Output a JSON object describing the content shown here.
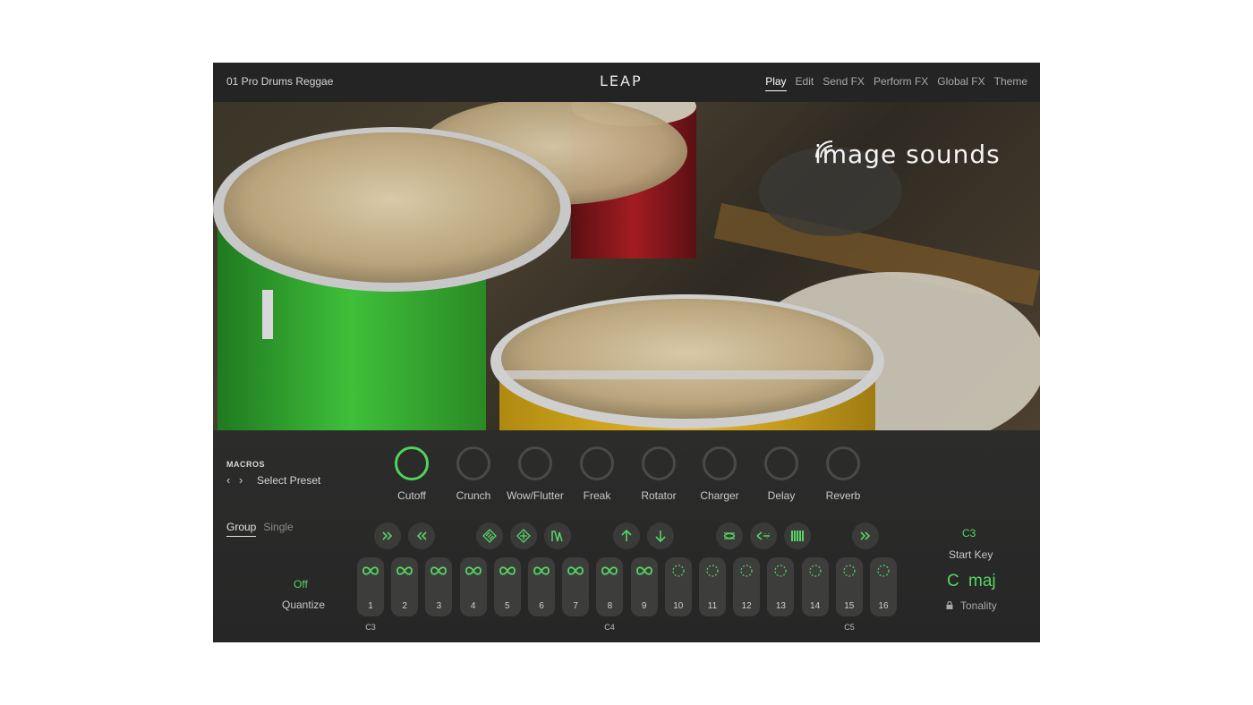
{
  "header": {
    "preset_name": "01 Pro Drums Reggae",
    "logo": "LEAP",
    "tabs": [
      {
        "label": "Play",
        "active": true
      },
      {
        "label": "Edit",
        "active": false
      },
      {
        "label": "Send FX",
        "active": false
      },
      {
        "label": "Perform FX",
        "active": false
      },
      {
        "label": "Global FX",
        "active": false
      },
      {
        "label": "Theme",
        "active": false
      }
    ]
  },
  "hero": {
    "brand": "image sounds",
    "brand_icon": "signal-waves-icon"
  },
  "macros": {
    "title": "MACROS",
    "preset_label": "Select Preset",
    "prev_icon": "chevron-left-icon",
    "next_icon": "chevron-right-icon",
    "knobs": [
      {
        "label": "Cutoff",
        "active": true
      },
      {
        "label": "Crunch",
        "active": false
      },
      {
        "label": "Wow/Flutter",
        "active": false
      },
      {
        "label": "Freak",
        "active": false
      },
      {
        "label": "Rotator",
        "active": false
      },
      {
        "label": "Charger",
        "active": false
      },
      {
        "label": "Delay",
        "active": false
      },
      {
        "label": "Reverb",
        "active": false
      }
    ]
  },
  "modes": {
    "tabs": [
      {
        "label": "Group",
        "active": true
      },
      {
        "label": "Single",
        "active": false
      }
    ]
  },
  "quantize": {
    "value": "Off",
    "label": "Quantize"
  },
  "fx_buttons": [
    {
      "name": "forward-double-icon"
    },
    {
      "name": "rewind-double-icon"
    },
    {
      "name": "grid-diagonal-icon"
    },
    {
      "name": "grid-diagonal-alt-icon"
    },
    {
      "name": "envelope-shape-icon"
    },
    {
      "name": "arrow-up-icon"
    },
    {
      "name": "arrow-down-icon"
    },
    {
      "name": "swap-arrows-icon"
    },
    {
      "name": "scatter-arrows-icon"
    },
    {
      "name": "bars-icon"
    },
    {
      "name": "forward-double-icon"
    }
  ],
  "pads": [
    {
      "number": "1",
      "loop": true
    },
    {
      "number": "2",
      "loop": true
    },
    {
      "number": "3",
      "loop": true
    },
    {
      "number": "4",
      "loop": true
    },
    {
      "number": "5",
      "loop": true
    },
    {
      "number": "6",
      "loop": true
    },
    {
      "number": "7",
      "loop": true
    },
    {
      "number": "8",
      "loop": true
    },
    {
      "number": "9",
      "loop": true
    },
    {
      "number": "10",
      "loop": false
    },
    {
      "number": "11",
      "loop": false
    },
    {
      "number": "12",
      "loop": false
    },
    {
      "number": "13",
      "loop": false
    },
    {
      "number": "14",
      "loop": false
    },
    {
      "number": "15",
      "loop": false
    },
    {
      "number": "16",
      "loop": false
    }
  ],
  "octave_labels": [
    "C3",
    "C4",
    "C5"
  ],
  "start_key": {
    "value": "C3",
    "label": "Start Key"
  },
  "tonality": {
    "root": "C",
    "type": "maj",
    "label": "Tonality",
    "icon": "lock-icon"
  },
  "colors": {
    "accent": "#55d564",
    "background": "#2a2a29",
    "header": "#242424"
  }
}
